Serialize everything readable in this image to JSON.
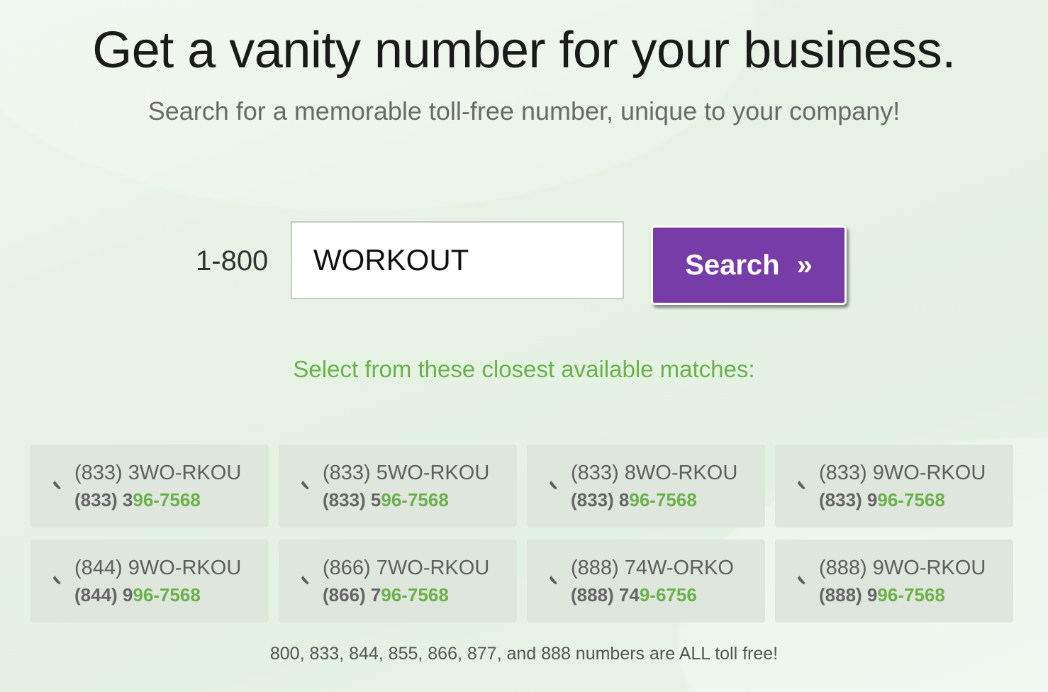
{
  "header": {
    "title": "Get a vanity number for your business.",
    "subtitle": "Search for a memorable toll-free number, unique to your company!"
  },
  "search": {
    "prefix": "1-800",
    "value": "WORKOUT",
    "button_label": "Search",
    "button_icon": "»"
  },
  "results": {
    "heading": "Select from these closest available matches:",
    "items": [
      {
        "vanity": "(833) 3WO-RKOU",
        "numeric_plain": "(833) 3",
        "numeric_match": "96-7568"
      },
      {
        "vanity": "(833) 5WO-RKOU",
        "numeric_plain": "(833) 5",
        "numeric_match": "96-7568"
      },
      {
        "vanity": "(833) 8WO-RKOU",
        "numeric_plain": "(833) 8",
        "numeric_match": "96-7568"
      },
      {
        "vanity": "(833) 9WO-RKOU",
        "numeric_plain": "(833) 9",
        "numeric_match": "96-7568"
      },
      {
        "vanity": "(844) 9WO-RKOU",
        "numeric_plain": "(844) 9",
        "numeric_match": "96-7568"
      },
      {
        "vanity": "(866) 7WO-RKOU",
        "numeric_plain": "(866) 7",
        "numeric_match": "96-7568"
      },
      {
        "vanity": "(888) 74W-ORKO",
        "numeric_plain": "(888) 74",
        "numeric_match": "9-6756"
      },
      {
        "vanity": "(888) 9WO-RKOU",
        "numeric_plain": "(888) 9",
        "numeric_match": "96-7568"
      }
    ]
  },
  "footer": {
    "note": "800, 833, 844, 855, 866, 877, and 888 numbers are ALL toll free!"
  },
  "colors": {
    "accent": "#773ca8",
    "match_green": "#6bb24a",
    "card_bg": "#dfe6de"
  },
  "icons": {
    "card": "phone-icon"
  }
}
